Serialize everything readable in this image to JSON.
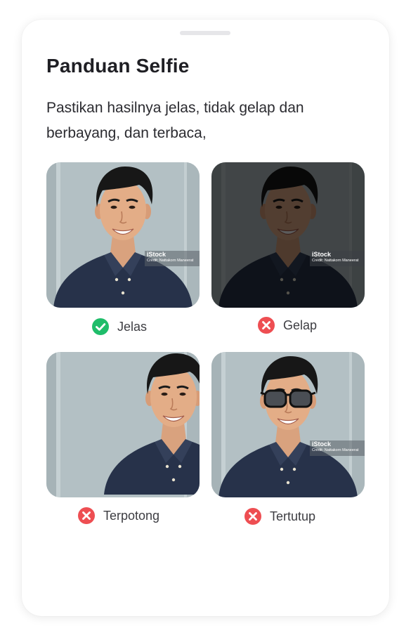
{
  "sheet": {
    "title": "Panduan Selfie",
    "description": "Pastikan hasilnya jelas, tidak gelap dan berbayang, dan terbaca,"
  },
  "colors": {
    "good": "#1fbd6a",
    "bad": "#ee4e52",
    "shirt": "#27324a",
    "background_wall": "#b3c0c4"
  },
  "examples": [
    {
      "label": "Jelas",
      "status": "good",
      "icon": "check-circle-icon",
      "watermark": {
        "brand": "iStock",
        "credit": "Credit: Nattakorn Maneerat"
      }
    },
    {
      "label": "Gelap",
      "status": "bad",
      "icon": "x-circle-icon",
      "watermark": {
        "brand": "iStock",
        "credit": "Credit: Nattakorn Maneerat"
      }
    },
    {
      "label": "Terpotong",
      "status": "bad",
      "icon": "x-circle-icon",
      "watermark": null
    },
    {
      "label": "Tertutup",
      "status": "bad",
      "icon": "x-circle-icon",
      "watermark": {
        "brand": "iStock",
        "credit": "Credit: Nattakorn Maneerat"
      }
    }
  ]
}
